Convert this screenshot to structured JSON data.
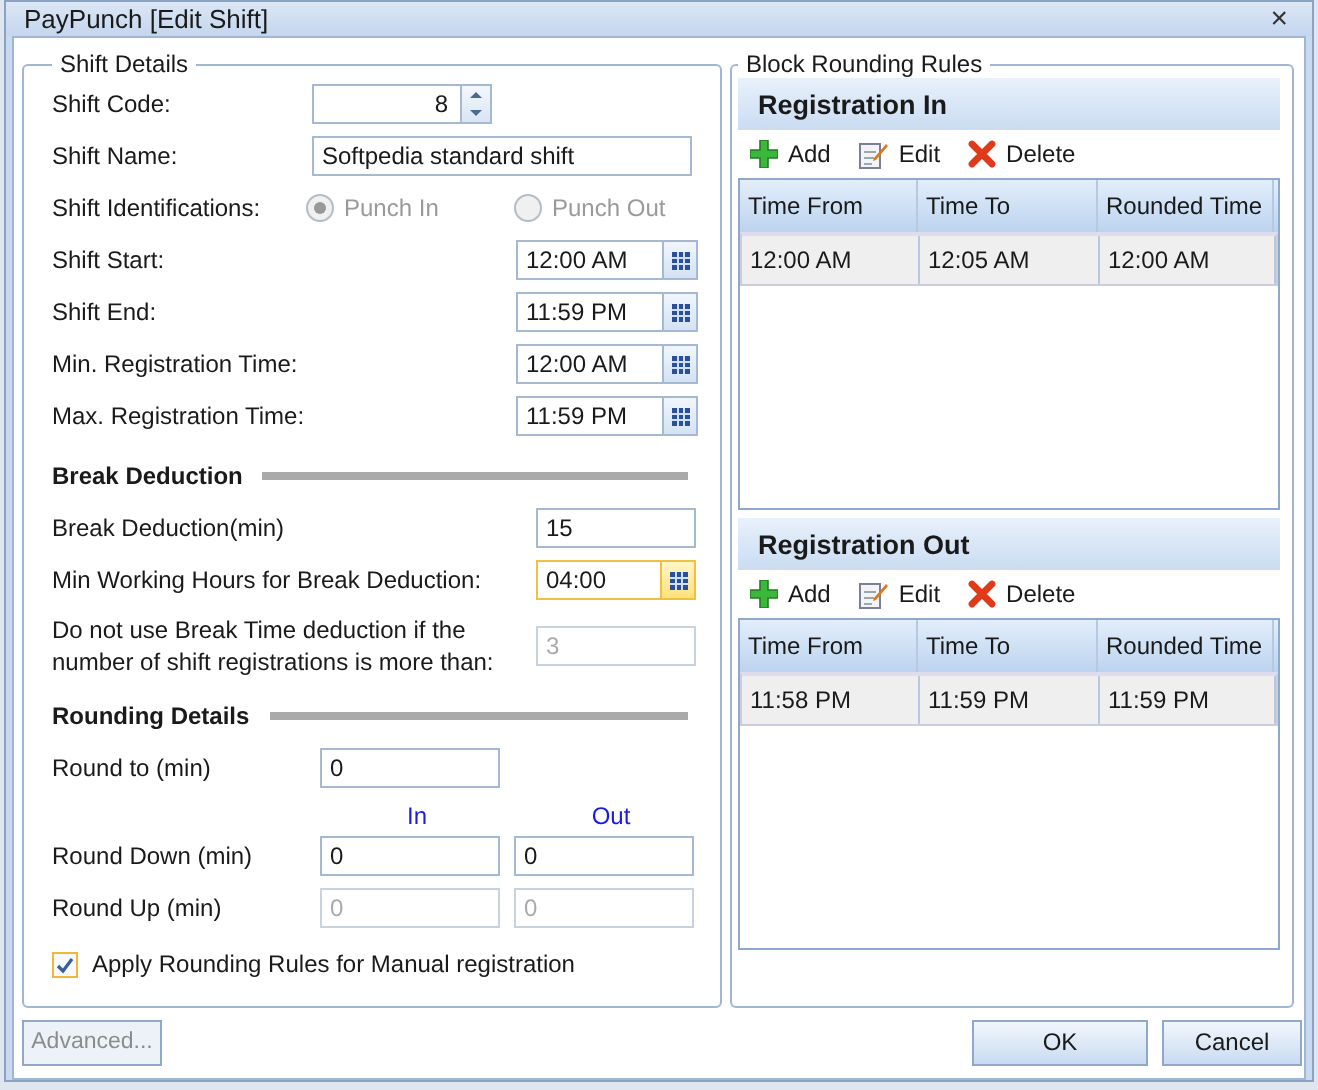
{
  "window": {
    "title": "PayPunch [Edit Shift]",
    "close": "×"
  },
  "shift_details": {
    "title": "Shift Details",
    "shift_code": {
      "label": "Shift Code:",
      "value": "8"
    },
    "shift_name": {
      "label": "Shift Name:",
      "value": "Softpedia standard shift"
    },
    "identifications": {
      "label": "Shift Identifications:",
      "options": [
        {
          "label": "Punch In",
          "selected": true,
          "disabled": true
        },
        {
          "label": "Punch Out",
          "selected": false,
          "disabled": true
        }
      ]
    },
    "times": [
      {
        "label": "Shift Start:",
        "value": "12:00 AM"
      },
      {
        "label": "Shift End:",
        "value": "11:59 PM"
      },
      {
        "label": "Min. Registration Time:",
        "value": "12:00 AM"
      },
      {
        "label": "Max. Registration Time:",
        "value": "11:59 PM"
      }
    ]
  },
  "break_deduction": {
    "title": "Break Deduction",
    "fields": [
      {
        "label": "Break Deduction(min)",
        "value": "15",
        "kind": "text",
        "focused": false,
        "disabled": false
      },
      {
        "label": "Min Working Hours for Break Deduction:",
        "value": "04:00",
        "kind": "time",
        "focused": true,
        "disabled": false
      },
      {
        "label": "Do not use Break Time deduction if the number of shift registrations is more than:",
        "value": "3",
        "kind": "text",
        "focused": false,
        "disabled": true
      }
    ]
  },
  "rounding": {
    "title": "Rounding Details",
    "round_to": {
      "label": "Round to (min)",
      "value": "0"
    },
    "columns": [
      "In",
      "Out"
    ],
    "rows": [
      {
        "label": "Round Down (min)",
        "in": {
          "value": "0",
          "disabled": false
        },
        "out": {
          "value": "0",
          "disabled": false
        }
      },
      {
        "label": "Round Up (min)",
        "in": {
          "value": "0",
          "disabled": true
        },
        "out": {
          "value": "0",
          "disabled": true
        }
      }
    ],
    "apply": {
      "label": "Apply Rounding Rules for Manual registration",
      "checked": true
    }
  },
  "block_rounding": {
    "title": "Block Rounding Rules",
    "sections": [
      {
        "title": "Registration In",
        "toolbar": [
          {
            "label": "Add",
            "kind": "add"
          },
          {
            "label": "Edit",
            "kind": "edit"
          },
          {
            "label": "Delete",
            "kind": "delete"
          }
        ],
        "columns": [
          "Time From",
          "Time To",
          "Rounded Time"
        ],
        "rows": [
          [
            "12:00 AM",
            "12:05 AM",
            "12:00 AM"
          ]
        ]
      },
      {
        "title": "Registration Out",
        "toolbar": [
          {
            "label": "Add",
            "kind": "add"
          },
          {
            "label": "Edit",
            "kind": "edit"
          },
          {
            "label": "Delete",
            "kind": "delete"
          }
        ],
        "columns": [
          "Time From",
          "Time To",
          "Rounded Time"
        ],
        "rows": [
          [
            "11:58 PM",
            "11:59 PM",
            "11:59 PM"
          ]
        ]
      }
    ]
  },
  "buttons": {
    "advanced": {
      "label": "Advanced...",
      "disabled": true
    },
    "ok": {
      "label": "OK"
    },
    "cancel": {
      "label": "Cancel"
    }
  }
}
